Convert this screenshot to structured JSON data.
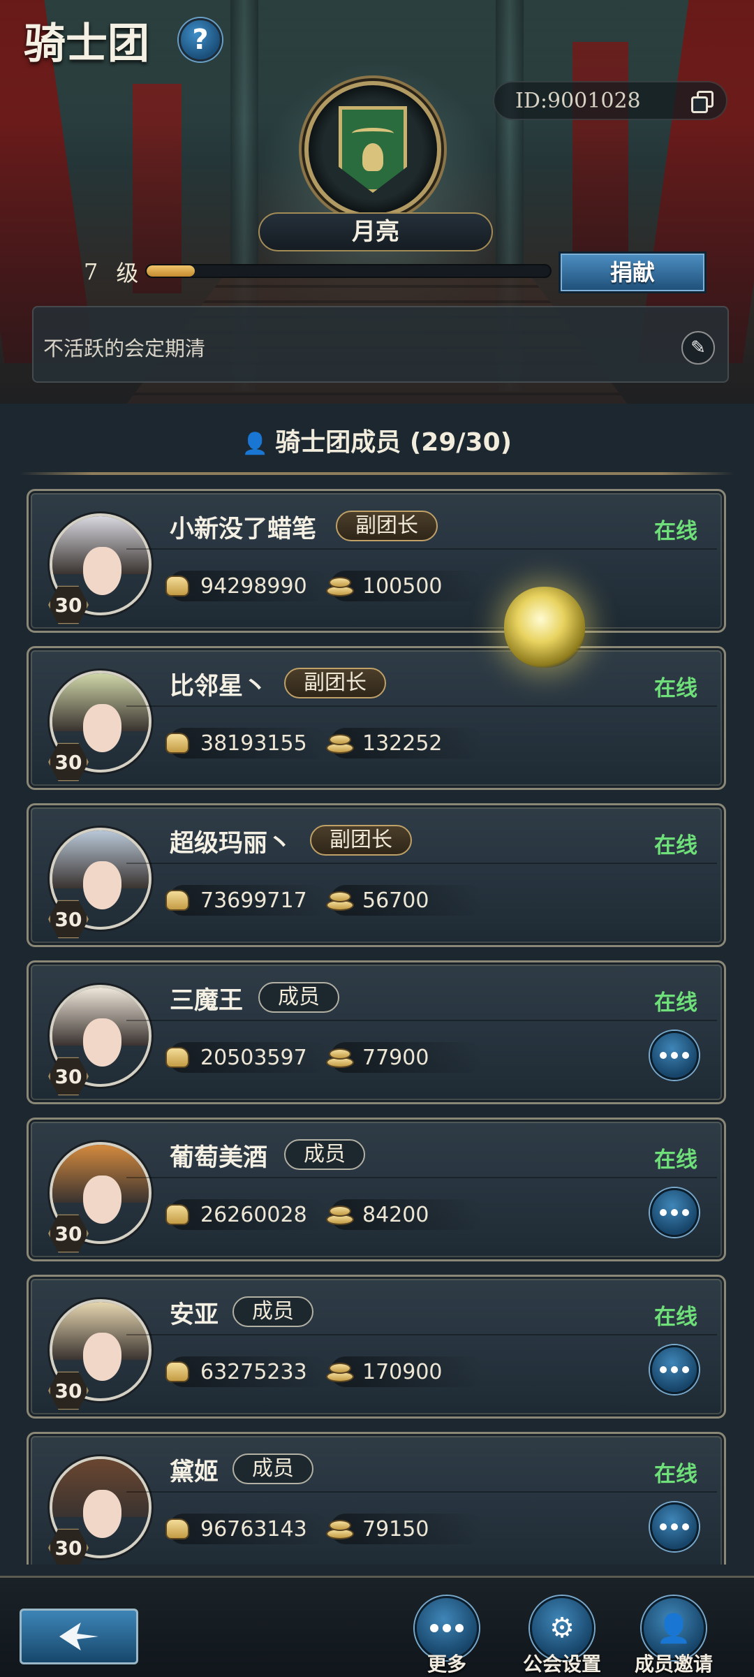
{
  "header": {
    "title": "骑士团",
    "help_label": "?",
    "id_text": "ID:9001028",
    "guild_name": "月亮",
    "level_number": "7",
    "level_unit": "级",
    "level_progress": 0.12,
    "donate_label": "捐献",
    "notice_text": "不活跃的会定期清"
  },
  "members_section": {
    "title": "骑士团成员 (29/30)"
  },
  "members": [
    {
      "name": "小新没了蜡笔",
      "role": "副团长",
      "status": "在线",
      "level": "30",
      "power": "94298990",
      "contribution": "100500"
    },
    {
      "name": "比邻星丶",
      "role": "副团长",
      "status": "在线",
      "level": "30",
      "power": "38193155",
      "contribution": "132252"
    },
    {
      "name": "超级玛丽丶",
      "role": "副团长",
      "status": "在线",
      "level": "30",
      "power": "73699717",
      "contribution": "56700"
    },
    {
      "name": "三魔王",
      "role": "成员",
      "status": "在线",
      "level": "30",
      "power": "20503597",
      "contribution": "77900"
    },
    {
      "name": "葡萄美酒",
      "role": "成员",
      "status": "在线",
      "level": "30",
      "power": "26260028",
      "contribution": "84200"
    },
    {
      "name": "安亚",
      "role": "成员",
      "status": "在线",
      "level": "30",
      "power": "63275233",
      "contribution": "170900"
    },
    {
      "name": "黛姬",
      "role": "成员",
      "status": "在线",
      "level": "30",
      "power": "96763143",
      "contribution": "79150"
    }
  ],
  "bottom_bar": {
    "more_label": "更多",
    "settings_label": "公会设置",
    "invite_label": "成员邀请"
  },
  "colors": {
    "online": "#6fdf7a",
    "accent_blue": "#3f86b8",
    "gold": "#c0a168"
  }
}
